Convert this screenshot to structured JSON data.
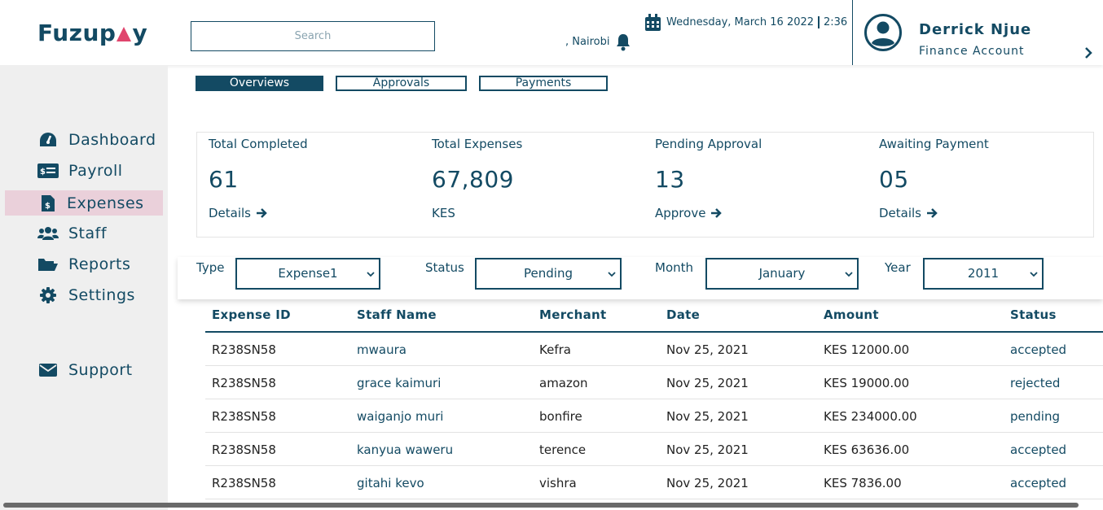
{
  "header": {
    "logo_text_pre": "Fuzup",
    "logo_text_post": "y",
    "search_placeholder": "Search",
    "location": ", Nairobi",
    "date": "Wednesday, March 16 2022",
    "time": "2:36",
    "user_name": "Derrick Njue",
    "user_role": "Finance  Account"
  },
  "sidebar": {
    "items": [
      {
        "label": "Dashboard",
        "icon": "gauge-icon"
      },
      {
        "label": "Payroll",
        "icon": "money-bill-icon"
      },
      {
        "label": "Expenses",
        "icon": "receipt-icon",
        "active": true
      },
      {
        "label": "Staff",
        "icon": "users-icon"
      },
      {
        "label": "Reports",
        "icon": "folder-icon"
      },
      {
        "label": "Settings",
        "icon": "gear-icon"
      },
      {
        "label": "Support",
        "icon": "envelope-icon"
      }
    ]
  },
  "tabs": [
    {
      "label": "Overviews",
      "active": true
    },
    {
      "label": "Approvals"
    },
    {
      "label": "Payments"
    }
  ],
  "stats": [
    {
      "label": "Total Completed",
      "value": "61",
      "link": "Details"
    },
    {
      "label": "Total Expenses",
      "value": "67,809",
      "link": "KES"
    },
    {
      "label": "Pending Approval",
      "value": "13",
      "link": "Approve"
    },
    {
      "label": "Awaiting Payment",
      "value": "05",
      "link": "Details"
    }
  ],
  "filters": {
    "type_label": "Type",
    "type_value": "Expense1",
    "status_label": "Status",
    "status_value": "Pending",
    "month_label": "Month",
    "month_value": "January",
    "year_label": "Year",
    "year_value": "2011"
  },
  "table": {
    "headers": [
      "Expense ID",
      "Staff Name",
      "Merchant",
      "Date",
      "Amount",
      "Status"
    ],
    "rows": [
      [
        "R238SN58",
        "mwaura",
        "Kefra",
        "Nov 25, 2021",
        "KES 12000.00",
        "accepted"
      ],
      [
        "R238SN58",
        "grace kaimuri",
        "amazon",
        "Nov 25, 2021",
        "KES 19000.00",
        "rejected"
      ],
      [
        "R238SN58",
        "waiganjo muri",
        "bonfire",
        "Nov 25, 2021",
        "KES 234000.00",
        "pending"
      ],
      [
        "R238SN58",
        "kanyua waweru",
        "terence",
        "Nov 25, 2021",
        "KES 63636.00",
        "accepted"
      ],
      [
        "R238SN58",
        "gitahi kevo",
        "vishra",
        "Nov 25, 2021",
        "KES 7836.00",
        "accepted"
      ]
    ]
  },
  "colors": {
    "primary": "#134a63",
    "accent": "#e0456d",
    "sidebar_bg": "#efefef",
    "active_nav_bg": "#ead0da"
  }
}
